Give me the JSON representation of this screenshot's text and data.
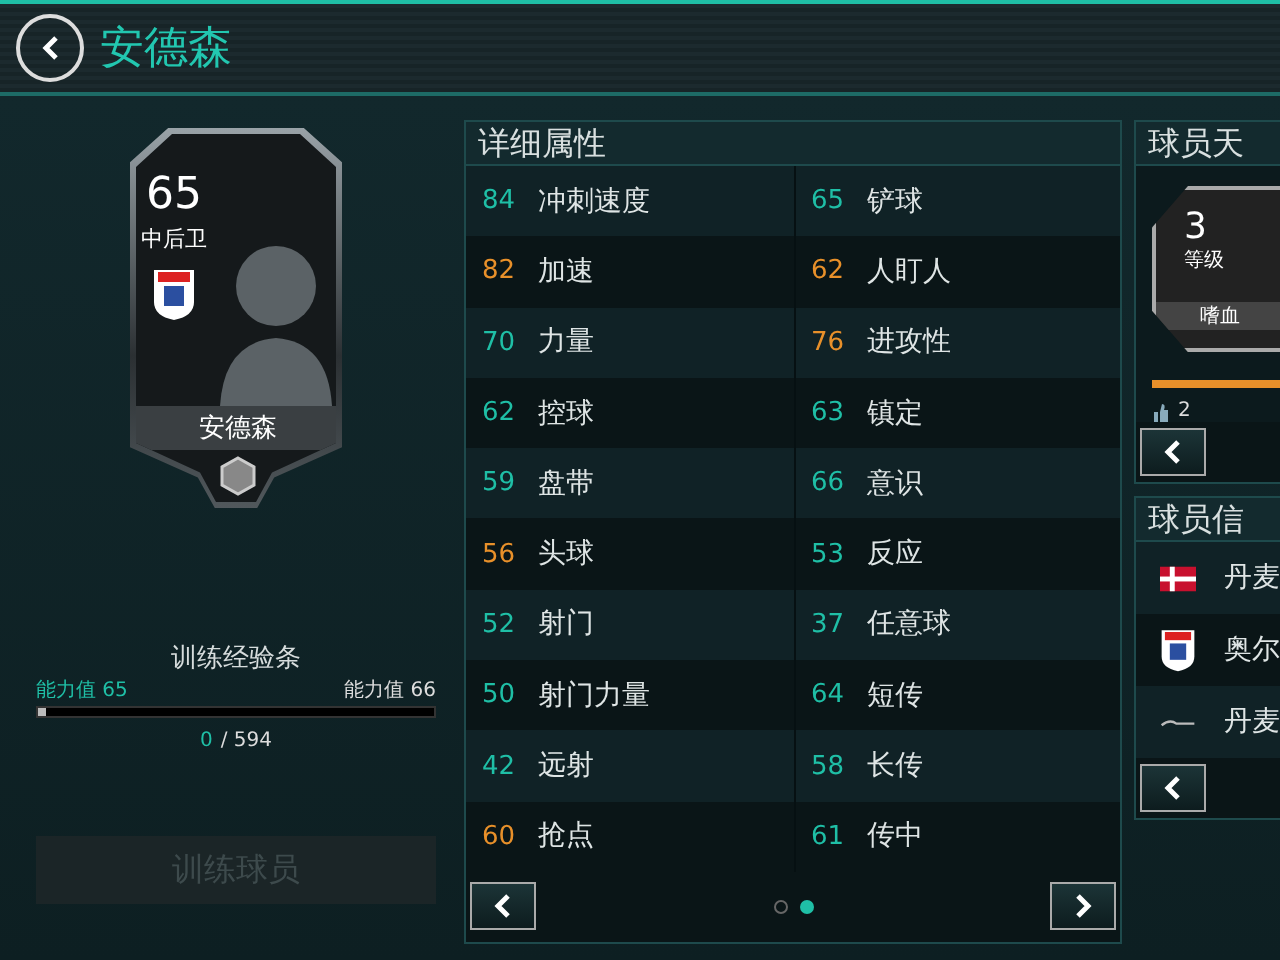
{
  "header": {
    "title": "安德森"
  },
  "player_card": {
    "rating": "65",
    "position": "中后卫",
    "name": "安德森"
  },
  "training": {
    "title": "训练经验条",
    "current_label": "能力值 65",
    "next_label": "能力值 66",
    "level": 0,
    "progress_current": "0",
    "progress_total": "/ 594",
    "button": {
      "label": "训练球员",
      "disabled": true
    }
  },
  "stats": {
    "title": "详细属性",
    "rows": [
      {
        "left": {
          "value": "84",
          "name": "冲刺速度",
          "color": "#1fbfa6"
        },
        "right": {
          "value": "65",
          "name": "铲球",
          "color": "#1fbfa6"
        }
      },
      {
        "left": {
          "value": "82",
          "name": "加速",
          "color": "#e8902a"
        },
        "right": {
          "value": "62",
          "name": "人盯人",
          "color": "#e8902a"
        }
      },
      {
        "left": {
          "value": "70",
          "name": "力量",
          "color": "#1fbfa6"
        },
        "right": {
          "value": "76",
          "name": "进攻性",
          "color": "#e8902a"
        }
      },
      {
        "left": {
          "value": "62",
          "name": "控球",
          "color": "#1fbfa6"
        },
        "right": {
          "value": "63",
          "name": "镇定",
          "color": "#1fbfa6"
        }
      },
      {
        "left": {
          "value": "59",
          "name": "盘带",
          "color": "#1fbfa6"
        },
        "right": {
          "value": "66",
          "name": "意识",
          "color": "#1fbfa6"
        }
      },
      {
        "left": {
          "value": "56",
          "name": "头球",
          "color": "#e8902a"
        },
        "right": {
          "value": "53",
          "name": "反应",
          "color": "#1fbfa6"
        }
      },
      {
        "left": {
          "value": "52",
          "name": "射门",
          "color": "#1fbfa6"
        },
        "right": {
          "value": "37",
          "name": "任意球",
          "color": "#1fbfa6"
        }
      },
      {
        "left": {
          "value": "50",
          "name": "射门力量",
          "color": "#1fbfa6"
        },
        "right": {
          "value": "64",
          "name": "短传",
          "color": "#1fbfa6"
        }
      },
      {
        "left": {
          "value": "42",
          "name": "远射",
          "color": "#1fbfa6"
        },
        "right": {
          "value": "58",
          "name": "长传",
          "color": "#1fbfa6"
        }
      },
      {
        "left": {
          "value": "60",
          "name": "抢点",
          "color": "#e8902a"
        },
        "right": {
          "value": "61",
          "name": "传中",
          "color": "#1fbfa6"
        }
      }
    ],
    "pages": [
      {
        "selected": false
      },
      {
        "selected": true
      }
    ]
  },
  "talent": {
    "title": "球员天",
    "level": "3",
    "level_label": "等级",
    "name": "嗜血",
    "progress": {
      "level": 1
    },
    "likes": "2"
  },
  "info": {
    "title": "球员信",
    "rows": [
      {
        "kind": "flag",
        "text": "丹麦"
      },
      {
        "kind": "club",
        "text": "奥尔"
      },
      {
        "kind": "league",
        "text": "丹麦"
      }
    ]
  }
}
